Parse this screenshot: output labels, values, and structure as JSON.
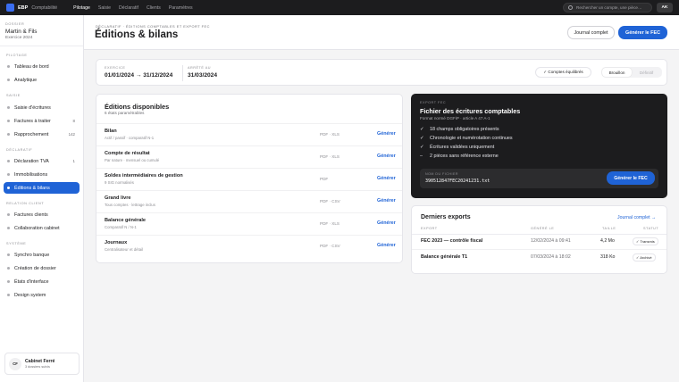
{
  "topbar": {
    "logo": "EBP",
    "app": "Comptabilité",
    "nav": [
      "Pilotage",
      "Saisie",
      "Déclaratif",
      "Clients",
      "Paramètres"
    ],
    "active_nav": "Pilotage",
    "search_placeholder": "Rechercher un compte, une pièce…",
    "user_initials": "AK"
  },
  "sidebar": {
    "dossier_label": "DOSSIER",
    "dossier_name": "Martin & Fils",
    "exercice": "Exercice 2024",
    "sections": [
      {
        "title": "PILOTAGE",
        "items": [
          {
            "label": "Tableau de bord",
            "count": ""
          },
          {
            "label": "Analytique",
            "count": ""
          }
        ]
      },
      {
        "title": "SAISIE",
        "items": [
          {
            "label": "Saisie d'écritures",
            "count": ""
          },
          {
            "label": "Factures à traiter",
            "count": "8"
          },
          {
            "label": "Rapprochement",
            "count": "142"
          }
        ]
      },
      {
        "title": "DÉCLARATIF",
        "items": [
          {
            "label": "Déclaration TVA",
            "count": "1"
          },
          {
            "label": "Immobilisations",
            "count": ""
          },
          {
            "label": "Éditions & bilans",
            "count": "",
            "active": true
          }
        ]
      },
      {
        "title": "RELATION CLIENT",
        "items": [
          {
            "label": "Factures clients",
            "count": ""
          },
          {
            "label": "Collaboration cabinet",
            "count": ""
          }
        ]
      },
      {
        "title": "SYSTÈME",
        "items": [
          {
            "label": "Synchro banque",
            "count": ""
          },
          {
            "label": "Création de dossier",
            "count": ""
          },
          {
            "label": "États d'interface",
            "count": ""
          },
          {
            "label": "Design system",
            "count": ""
          }
        ]
      }
    ],
    "footer": {
      "initials": "CF",
      "name": "Cabinet Ferré",
      "sub": "3 dossiers suivis"
    }
  },
  "header": {
    "breadcrumb": "DÉCLARATIF · ÉDITIONS COMPTABLES ET EXPORT FEC",
    "title": "Éditions & bilans",
    "btn_journal": "Journal complet",
    "btn_fec": "Générer le FEC"
  },
  "period": {
    "exercice_label": "EXERCICE",
    "exercice_value": "01/01/2024 → 31/12/2024",
    "arrete_label": "ARRÊTÉ AU",
    "arrete_value": "31/03/2024",
    "balance_pill": "✓ Comptes équilibrés",
    "modes": [
      "Brouillon",
      "Définitif"
    ],
    "active_mode": "Brouillon"
  },
  "editions": {
    "title": "Éditions disponibles",
    "subtitle": "6 états paramétrables",
    "generate_label": "Générer",
    "rows": [
      {
        "name": "Bilan",
        "desc": "Actif / passif · comparatif N-1",
        "formats": "PDF · XLS"
      },
      {
        "name": "Compte de résultat",
        "desc": "Par nature · mensuel ou cumulé",
        "formats": "PDF · XLS"
      },
      {
        "name": "Soldes intermédiaires de gestion",
        "desc": "9 SIG normalisés",
        "formats": "PDF"
      },
      {
        "name": "Grand livre",
        "desc": "Tous comptes · lettrage inclus",
        "formats": "PDF · CSV"
      },
      {
        "name": "Balance générale",
        "desc": "Comparatif N / N-1",
        "formats": "PDF · XLS"
      },
      {
        "name": "Journaux",
        "desc": "Centralisateur et détail",
        "formats": "PDF · CSV"
      }
    ]
  },
  "fec": {
    "label": "EXPORT FEC",
    "title": "Fichier des écritures comptables",
    "subtitle": "Format normé DGFiP · article A 47 A-1",
    "checks": [
      {
        "icon": "✓",
        "text": "18 champs obligatoires présents"
      },
      {
        "icon": "✓",
        "text": "Chronologie et numérotation continues"
      },
      {
        "icon": "✓",
        "text": "Écritures validées uniquement"
      },
      {
        "icon": "–",
        "text": "2 pièces sans référence externe"
      }
    ],
    "file_label": "NOM DU FICHIER",
    "file_name": "390512847FEC20241231.txt",
    "button": "Générer le FEC"
  },
  "exports": {
    "title": "Derniers exports",
    "link": "Journal complet →",
    "headers": [
      "EXPORT",
      "GÉNÉRÉ LE",
      "TAILLE",
      "STATUT"
    ],
    "rows": [
      {
        "name": "FEC 2023 — contrôle fiscal",
        "date": "12/02/2024 à 09:41",
        "size": "4,2 Mo",
        "status": "✓ Transmis"
      },
      {
        "name": "Balance générale T1",
        "date": "07/03/2024 à 18:02",
        "size": "318 Ko",
        "status": "✓ Archivé"
      }
    ]
  }
}
